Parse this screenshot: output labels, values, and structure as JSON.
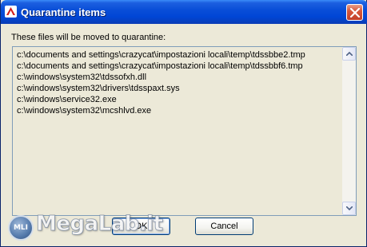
{
  "window": {
    "title": "Quarantine items",
    "app_icon": "avira-umbrella-icon",
    "close_icon": "close-icon"
  },
  "prompt": "These files will be moved to quarantine:",
  "files": [
    "c:\\documents and settings\\crazycat\\impostazioni locali\\temp\\tdssbbe2.tmp",
    "c:\\documents and settings\\crazycat\\impostazioni locali\\temp\\tdssbbf6.tmp",
    "c:\\windows\\system32\\tdssofxh.dll",
    "c:\\windows\\system32\\drivers\\tdsspaxt.sys",
    "c:\\windows\\service32.exe",
    "c:\\windows\\system32\\mcshlvd.exe"
  ],
  "buttons": {
    "ok": "OK",
    "cancel": "Cancel"
  },
  "watermark": {
    "text": "MegaLab.it",
    "badge": "MLI"
  },
  "colors": {
    "titlebar": "#0046d5",
    "close_button": "#d7583b",
    "window_bg": "#ece9d8",
    "list_border": "#7f9db9"
  }
}
